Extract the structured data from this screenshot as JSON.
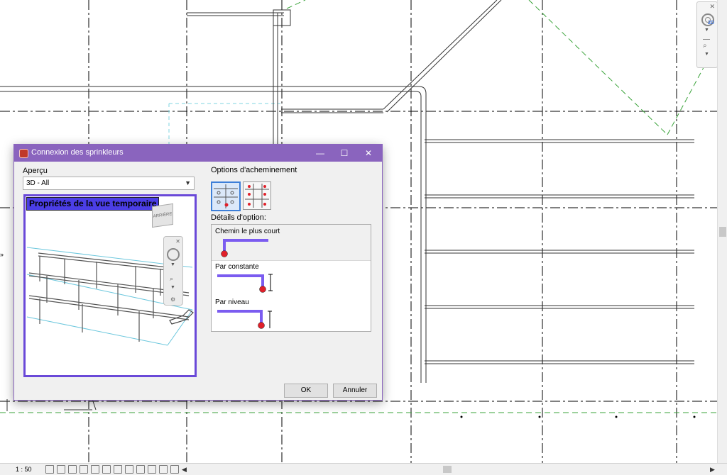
{
  "status_bar": {
    "scale": "1 : 50"
  },
  "dialog": {
    "title": "Connexion des sprinkleurs",
    "window_controls": {
      "minimize": "—",
      "maximize": "☐",
      "close": "✕"
    },
    "preview": {
      "label": "Aperçu",
      "view_select_value": "3D - All",
      "view_title": "Propriétés de la vue temporaire"
    },
    "routing": {
      "label": "Options d'acheminement",
      "details_label": "Détails d'option:",
      "options": [
        {
          "label": "Chemin le plus court",
          "selected": true
        },
        {
          "label": "Par constante",
          "selected": false
        },
        {
          "label": "Par niveau",
          "selected": false
        }
      ]
    },
    "buttons": {
      "ok": "OK",
      "cancel": "Annuler"
    }
  },
  "colors": {
    "title_bar": "#8a64be",
    "preview_border": "#6a49d8",
    "pipe_purple": "#7b5cf0",
    "sprinkler_red": "#e0202a",
    "grid_green": "#3aa33a"
  }
}
